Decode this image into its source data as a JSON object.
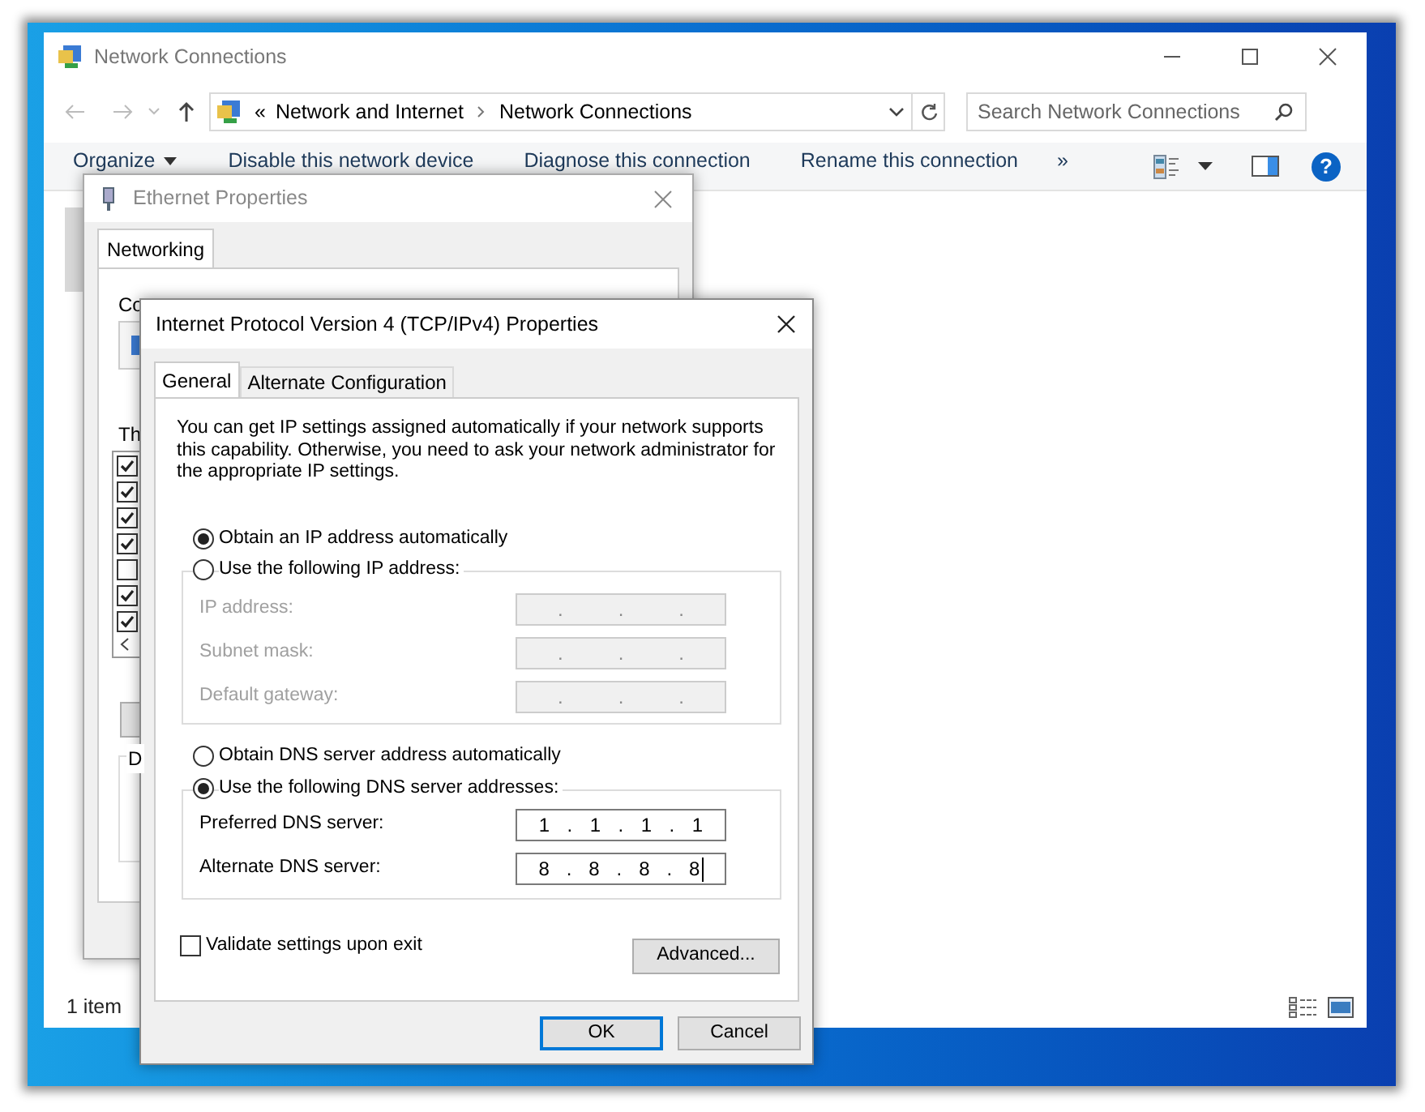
{
  "explorer": {
    "title": "Network Connections",
    "address": {
      "prefix": "«",
      "breadcrumbs": [
        "Network and Internet",
        "Network Connections"
      ]
    },
    "search": {
      "placeholder": "Search Network Connections"
    },
    "toolbar": [
      {
        "label": "Organize",
        "dropdown": true
      },
      {
        "label": "Disable this network device",
        "dropdown": false
      },
      {
        "label": "Diagnose this connection",
        "dropdown": false
      },
      {
        "label": "Rename this connection",
        "dropdown": false
      },
      {
        "label": "»",
        "dropdown": false
      }
    ],
    "help": "?",
    "status": "1 item"
  },
  "ethernet_dialog": {
    "title": "Ethernet Properties",
    "tabs": [
      {
        "label": "Networking",
        "selected": true
      }
    ],
    "labels": [
      "Co",
      "Th",
      "D"
    ],
    "components": [
      {
        "checked": true
      },
      {
        "checked": true
      },
      {
        "checked": true
      },
      {
        "checked": true
      },
      {
        "checked": false
      },
      {
        "checked": true
      },
      {
        "checked": true
      }
    ]
  },
  "ipv4_dialog": {
    "title": "Internet Protocol Version 4 (TCP/IPv4) Properties",
    "tabs": [
      {
        "label": "General",
        "selected": true
      },
      {
        "label": "Alternate Configuration",
        "selected": false
      }
    ],
    "description": "You can get IP settings assigned automatically if your network supports this capability. Otherwise, you need to ask your network administrator for the appropriate IP settings.",
    "ip_mode": [
      {
        "label": "Obtain an IP address automatically",
        "selected": true
      },
      {
        "label": "Use the following IP address:",
        "selected": false
      }
    ],
    "ip_fields": [
      {
        "label": "IP address:",
        "parts": [
          ".",
          ".",
          "."
        ],
        "disabled": true
      },
      {
        "label": "Subnet mask:",
        "parts": [
          ".",
          ".",
          "."
        ],
        "disabled": true
      },
      {
        "label": "Default gateway:",
        "parts": [
          ".",
          ".",
          "."
        ],
        "disabled": true
      }
    ],
    "dns_mode": [
      {
        "label": "Obtain DNS server address automatically",
        "selected": false
      },
      {
        "label": "Use the following DNS server addresses:",
        "selected": true
      }
    ],
    "dns_fields": [
      {
        "label": "Preferred DNS server:",
        "parts": [
          "1",
          ".",
          "1",
          ".",
          "1",
          ".",
          "1"
        ],
        "disabled": false,
        "focused": false
      },
      {
        "label": "Alternate DNS server:",
        "parts": [
          "8",
          ".",
          "8",
          ".",
          "8",
          ".",
          "8"
        ],
        "disabled": false,
        "focused": true
      }
    ],
    "validate": {
      "label": "Validate settings upon exit",
      "checked": false
    },
    "advanced_button": "Advanced...",
    "buttons": [
      {
        "label": "OK",
        "default": true
      },
      {
        "label": "Cancel",
        "default": false
      }
    ]
  }
}
